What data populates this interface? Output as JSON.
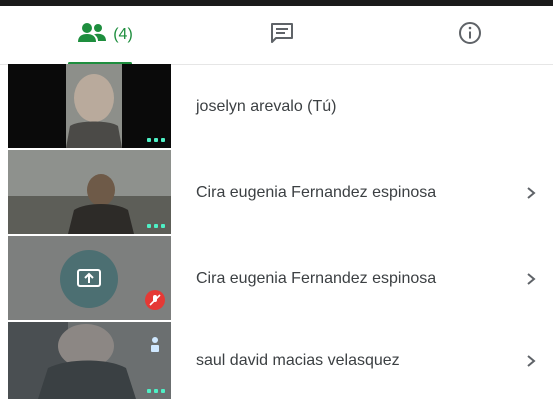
{
  "tabs": {
    "people": {
      "icon": "people-icon",
      "count_label": "(4)"
    },
    "chat": {
      "icon": "chat-icon"
    },
    "info": {
      "icon": "info-icon"
    }
  },
  "participants": [
    {
      "name": "joselyn arevalo (Tú)",
      "tile": "video",
      "has_chevron": false
    },
    {
      "name": "Cira eugenia Fernandez espinosa",
      "tile": "video",
      "has_chevron": true
    },
    {
      "name": "Cira eugenia Fernandez espinosa",
      "tile": "presentation",
      "muted": true,
      "has_chevron": true
    },
    {
      "name": "saul david macias velasquez",
      "tile": "video",
      "has_chevron": true
    }
  ],
  "colors": {
    "accent": "#1e8e3e",
    "text": "#3c4043",
    "mute": "#e53935",
    "dots": "#4ef0c5"
  }
}
